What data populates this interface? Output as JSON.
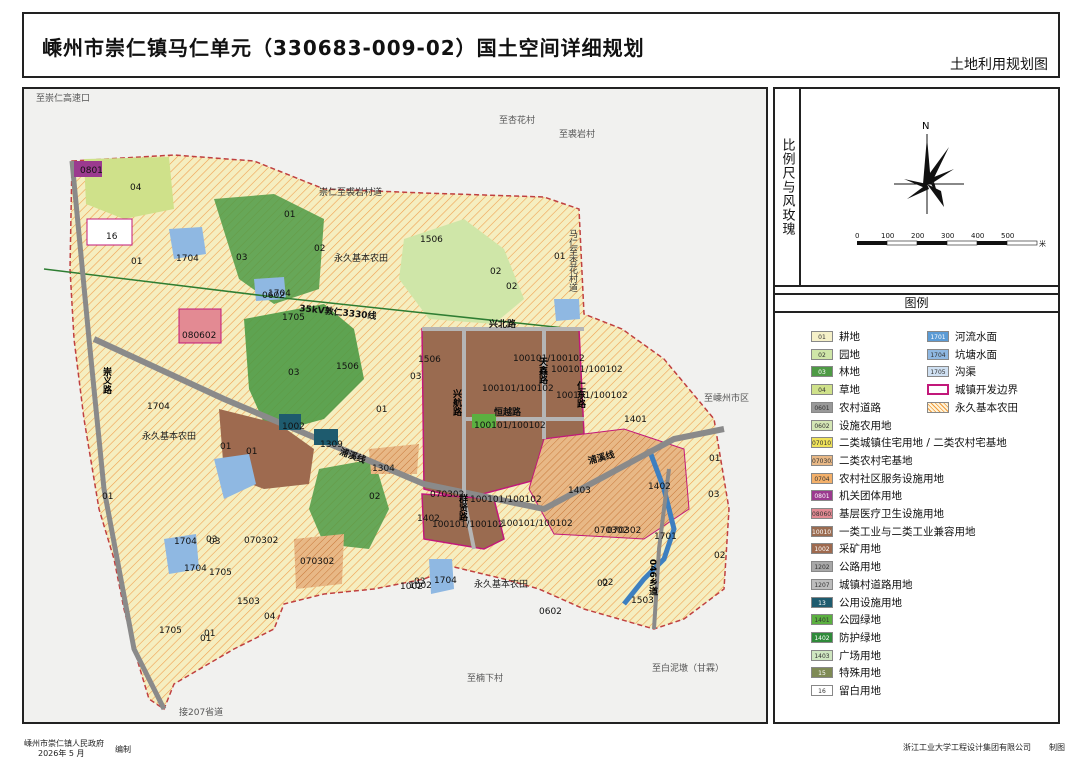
{
  "title": {
    "main": "嵊州市崇仁镇马仁单元（330683-009-02）国土空间详细规划",
    "sub": "土地利用规划图"
  },
  "side": {
    "scale_label": "比例尺与风玫瑰",
    "north": "N",
    "scale_ticks": [
      "0",
      "100",
      "200",
      "300",
      "400",
      "500"
    ],
    "scale_unit": "米",
    "legend_title": "图例"
  },
  "legend": [
    {
      "code": "01",
      "label": "耕地",
      "color": "#f5f0c8"
    },
    {
      "code": "02",
      "label": "园地",
      "color": "#cfe6a8"
    },
    {
      "code": "03",
      "label": "林地",
      "color": "#4e9a45"
    },
    {
      "code": "04",
      "label": "草地",
      "color": "#cfe18a"
    },
    {
      "code": "0601",
      "label": "农村道路",
      "color": "#999999"
    },
    {
      "code": "0602",
      "label": "设施农用地",
      "color": "#d4e6b5"
    },
    {
      "code": "070101/070102",
      "label": "二类城镇住宅用地 / 二类农村宅基地",
      "color": "#f0e35a"
    },
    {
      "code": "070302",
      "label": "二类农村宅基地",
      "color": "#e8b886"
    },
    {
      "code": "0704",
      "label": "农村社区服务设施用地",
      "color": "#f3b06a"
    },
    {
      "code": "0801",
      "label": "机关团体用地",
      "color": "#9b3a8f"
    },
    {
      "code": "080602",
      "label": "基层医疗卫生设施用地",
      "color": "#e38a93"
    },
    {
      "code": "100101/100102",
      "label": "一类工业与二类工业兼容用地",
      "color": "#9a6b50"
    },
    {
      "code": "1002",
      "label": "采矿用地",
      "color": "#9e6a4f"
    },
    {
      "code": "1202",
      "label": "公路用地",
      "color": "#a8a8a8"
    },
    {
      "code": "1207",
      "label": "城镇村道路用地",
      "color": "#bdbdbd"
    },
    {
      "code": "13",
      "label": "公用设施用地",
      "color": "#1e5b6e"
    },
    {
      "code": "1401",
      "label": "公园绿地",
      "color": "#5bb040"
    },
    {
      "code": "1402",
      "label": "防护绿地",
      "color": "#2f8a3a"
    },
    {
      "code": "1403",
      "label": "广场用地",
      "color": "#cfe6c0"
    },
    {
      "code": "15",
      "label": "特殊用地",
      "color": "#7e8a55"
    },
    {
      "code": "16",
      "label": "留白用地",
      "color": "#ffffff"
    },
    {
      "code": "1701",
      "label": "河流水面",
      "color": "#5b9bd5"
    },
    {
      "code": "1704",
      "label": "坑塘水面",
      "color": "#8fb8e2"
    },
    {
      "code": "1705",
      "label": "沟渠",
      "color": "#cfe0f2"
    },
    {
      "code": "",
      "label": "城镇开发边界",
      "color": "#c2187a"
    },
    {
      "code": "",
      "label": "永久基本农田",
      "color": "#f09a3a"
    }
  ],
  "map": {
    "places": [
      "至崇仁高速口",
      "至杏花村",
      "至裘岩村",
      "崇仁至裘岩村道",
      "马仁至杏花村道",
      "至嵊州市区",
      "至白泥墩（甘霖）",
      "至楠下村",
      "接207省道"
    ],
    "roads": [
      "35kV敦仁3330线",
      "兴北路",
      "天鑫路",
      "仁东路",
      "恒越路",
      "兴航路",
      "浦溪线",
      "群贤路",
      "崇义路",
      "046乡道"
    ],
    "farmland_labels": [
      "永久基本农田",
      "永久基本农田",
      "永久基本农田"
    ],
    "parcels": [
      "0801",
      "04",
      "16",
      "01",
      "1704",
      "03",
      "02",
      "1506",
      "01",
      "02",
      "01",
      "1506",
      "1704",
      "1705",
      "080602",
      "03",
      "1506",
      "01",
      "02",
      "0602",
      "1704",
      "01",
      "03",
      "100101/100102",
      "100101/100102",
      "100101/100102",
      "100101/100102",
      "100101/100102",
      "1401",
      "01",
      "1002",
      "1309",
      "1304",
      "070302",
      "100101/100102",
      "1402",
      "1403",
      "1402",
      "070302",
      "070302",
      "02",
      "03",
      "03",
      "1704",
      "03",
      "01",
      "070302",
      "1705",
      "1503",
      "04",
      "1704",
      "1002",
      "01",
      "1705",
      "01",
      "100101/100102",
      "070302",
      "1704",
      "0602",
      "02",
      "1503",
      "1701",
      "01",
      "03",
      "02",
      "100101/100102",
      "1002",
      "02"
    ]
  },
  "footer": {
    "left1": "嵊州市崇仁镇人民政府",
    "left2": "2026年 5 月",
    "mid": "编制",
    "right": "浙江工业大学工程设计集团有限公司",
    "right2": "制图"
  }
}
